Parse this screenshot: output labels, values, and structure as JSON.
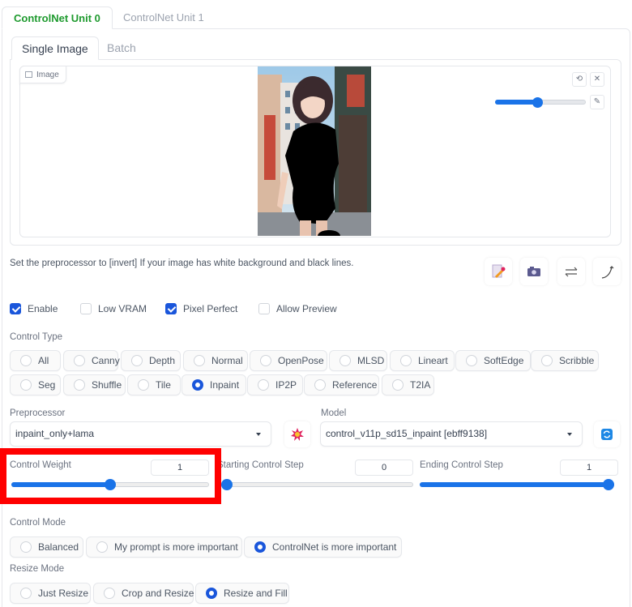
{
  "unit_tabs": [
    {
      "label": "ControlNet Unit 0",
      "active": true
    },
    {
      "label": "ControlNet Unit 1",
      "active": false
    }
  ],
  "image_tabs": [
    {
      "label": "Single Image",
      "active": true
    },
    {
      "label": "Batch",
      "active": false
    }
  ],
  "image_panel": {
    "label": "Image",
    "label_icon": "image-icon",
    "tools": {
      "undo_icon": "undo-icon",
      "undo_glyph": "⟲",
      "clear_icon": "close-icon",
      "clear_glyph": "✕",
      "brush_icon": "brush-icon",
      "brush_glyph": "✎"
    },
    "brush_size_fraction": 0.46,
    "image_description": "Anime-style girl on a city street with black inpaint mask over the body"
  },
  "hint": "Set the preprocessor to [invert] If your image has white background and black lines.",
  "action_icons": [
    {
      "name": "create-canvas-icon",
      "glyph": "📝"
    },
    {
      "name": "camera-icon",
      "glyph": "📷"
    },
    {
      "name": "swap-icon",
      "glyph": "⇄"
    },
    {
      "name": "send-dimensions-icon",
      "glyph": "⤴"
    }
  ],
  "checkboxes": [
    {
      "label": "Enable",
      "checked": true
    },
    {
      "label": "Low VRAM",
      "checked": false
    },
    {
      "label": "Pixel Perfect",
      "checked": true
    },
    {
      "label": "Allow Preview",
      "checked": false
    }
  ],
  "control_type": {
    "label": "Control Type",
    "options": [
      "All",
      "Canny",
      "Depth",
      "Normal",
      "OpenPose",
      "MLSD",
      "Lineart",
      "SoftEdge",
      "Scribble",
      "Seg",
      "Shuffle",
      "Tile",
      "Inpaint",
      "IP2P",
      "Reference",
      "T2IA"
    ],
    "selected": "Inpaint"
  },
  "preprocessor": {
    "label": "Preprocessor",
    "value": "inpaint_only+lama",
    "run_icon": "explosion-icon",
    "run_glyph": "💥"
  },
  "model": {
    "label": "Model",
    "value": "control_v11p_sd15_inpaint [ebff9138]",
    "refresh_icon": "refresh-icon",
    "refresh_glyph": "🔄"
  },
  "sliders": [
    {
      "label": "Control Weight",
      "value": "1",
      "fraction": 0.5
    },
    {
      "label": "Starting Control Step",
      "value": "0",
      "fraction": 0.0
    },
    {
      "label": "Ending Control Step",
      "value": "1",
      "fraction": 1.0
    }
  ],
  "control_mode": {
    "label": "Control Mode",
    "options": [
      "Balanced",
      "My prompt is more important",
      "ControlNet is more important"
    ],
    "selected": "ControlNet is more important"
  },
  "resize_mode": {
    "label": "Resize Mode",
    "options": [
      "Just Resize",
      "Crop and Resize",
      "Resize and Fill"
    ],
    "selected": "Resize and Fill"
  },
  "colors": {
    "accent": "#1a73e8",
    "active_tab": "#1e9a2e",
    "highlight": "#ff0000"
  }
}
